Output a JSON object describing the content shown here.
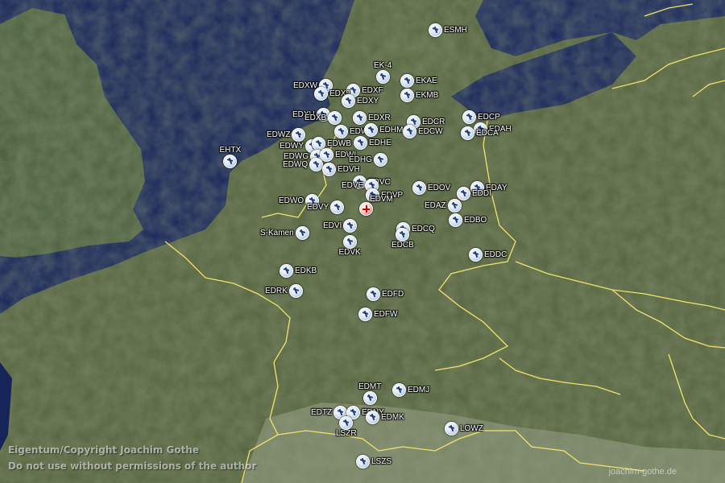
{
  "colors": {
    "sea": "#16245a",
    "land": "#51603a",
    "border": "#f2e36a",
    "label": "#ffffff"
  },
  "copyright": {
    "line1": "Eigentum/Copyright Joachim Gothe",
    "line2": "Do not use without permissions of the author"
  },
  "watermark": "joachim-gothe.de",
  "home_label": "EDVM",
  "markers": [
    "ESMH",
    "EDXW",
    "EDXF",
    "EK-4",
    "EKAE",
    "EKMB",
    "EDXJ",
    "EDXY",
    "EDXH",
    "EDXB",
    "EDXR",
    "EDCR",
    "EDCP",
    "EDAH",
    "EDWZ",
    "EDWG",
    "EDHM",
    "EDWY",
    "EDWB",
    "EDHE",
    "EDCW",
    "EDCA",
    "EDWG",
    "EDWI",
    "EDHG",
    "EHTX",
    "EDWQ",
    "EDVH",
    "EDVC",
    "EDOV",
    "EDAY",
    "EDWO",
    "EDVE",
    "EDVP",
    "EDDI",
    "EDVY",
    "EDAZ",
    "EDBO",
    "S-Kamen",
    "EDVI",
    "EDCQ",
    "EDCB",
    "EDVK",
    "EDDC",
    "EDKB",
    "EDRK",
    "EDFD",
    "EDFW",
    "EDMJ",
    "EDMT",
    "EDTZ",
    "EDNY",
    "EDMK",
    "LOWZ",
    "LSZR",
    "LSZS"
  ]
}
